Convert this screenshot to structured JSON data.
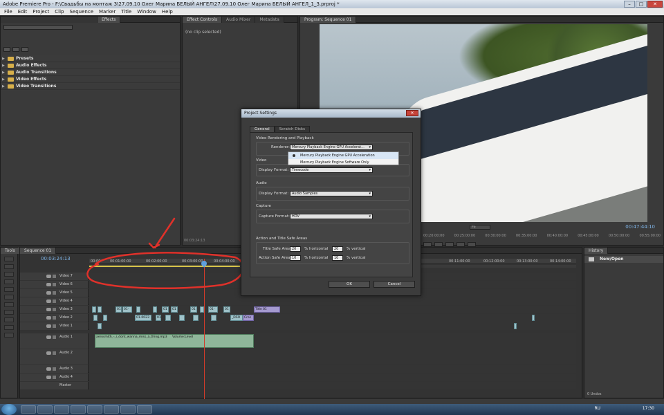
{
  "app": {
    "title": "Adobe Premiere Pro - F:\\Свадьбы на монтаж 3\\27.09.10 Олег Марина БЕЛЫЙ АНГЕЛ\\27.09.10 Олег Марина БЕЛЫЙ АНГЕЛ_1_3.prproj *"
  },
  "menu": [
    "File",
    "Edit",
    "Project",
    "Clip",
    "Sequence",
    "Marker",
    "Title",
    "Window",
    "Help"
  ],
  "effects_panel": {
    "tab": "Effects",
    "items": [
      "Presets",
      "Audio Effects",
      "Audio Transitions",
      "Video Effects",
      "Video Transitions"
    ]
  },
  "effect_controls": {
    "tabs": [
      "Effect Controls",
      "Audio Mixer",
      "Metadata"
    ],
    "clip_status": "(no clip selected)",
    "timecode": "00:03:24:13"
  },
  "program": {
    "tab": "Program: Sequence 01",
    "timecode": "00:47:44:10",
    "fit": "Fit",
    "ruler": [
      "00:20:00:00",
      "00:25:00:00",
      "00:30:00:00",
      "00:35:00:00",
      "00:40:00:00",
      "00:45:00:00",
      "00:50:00:00",
      "00:55:00:00"
    ]
  },
  "tools_panel": {
    "tab": "Tools"
  },
  "sequence": {
    "tab": "Sequence 01",
    "timecode": "00:03:24:13",
    "ruler": [
      "00:00",
      "00:01:00:00",
      "00:02:00:00",
      "00:03:00:00",
      "00:04:00:00"
    ],
    "ruler_right": [
      "00:11:00:00",
      "00:12:00:00",
      "00:13:00:00",
      "00:14:00:00"
    ],
    "tracks": [
      {
        "name": "Video 7"
      },
      {
        "name": "Video 6"
      },
      {
        "name": "Video 5"
      },
      {
        "name": "Video 4"
      },
      {
        "name": "Video 3"
      },
      {
        "name": "Video 2"
      },
      {
        "name": "Video 1"
      },
      {
        "name": "Audio 1"
      },
      {
        "name": "Audio 2"
      },
      {
        "name": "Audio 3"
      },
      {
        "name": "Audio 4"
      },
      {
        "name": "Master"
      }
    ],
    "clips": {
      "v3_labels": [
        "01",
        "01-",
        "01",
        "01",
        "01",
        "01-",
        "01"
      ],
      "v3_title": "Title 01",
      "v2_labels": [
        "01-0023",
        "01",
        "_DSO",
        "Cros"
      ],
      "a1_label": "aerosmith_-_i_dont_wanna_miss_a_thing.mp3",
      "a1_volume": "Volume:Level"
    }
  },
  "history": {
    "tab": "History",
    "item": "New/Open",
    "undos": "0 Undos"
  },
  "dialog": {
    "title": "Project Settings",
    "close": "✕",
    "tabs": [
      "General",
      "Scratch Disks"
    ],
    "video_rendering": {
      "group": "Video Rendering and Playback",
      "label": "Renderer:",
      "value": "Mercury Playback Engine GPU Accelerat...",
      "options": [
        "Mercury Playback Engine GPU Acceleration",
        "Mercury Playback Engine Software Only"
      ]
    },
    "video": {
      "group": "Video",
      "label": "Display Format:",
      "value": "Timecode"
    },
    "audio": {
      "group": "Audio",
      "label": "Display Format:",
      "value": "Audio Samples"
    },
    "capture": {
      "group": "Capture",
      "label": "Capture Format:",
      "value": "HDV"
    },
    "safe_areas": {
      "group": "Action and Title Safe Areas",
      "title_label": "Title Safe Area",
      "title_h": "20",
      "title_v": "20",
      "action_label": "Action Safe Area",
      "action_h": "10",
      "action_v": "10",
      "h_unit": "% horizontal",
      "v_unit": "% vertical"
    },
    "ok": "OK",
    "cancel": "Cancel"
  },
  "taskbar": {
    "lang": "RU",
    "clock": "17:30"
  },
  "colors": {
    "playhead": "#d23b2a",
    "timecode": "#7fb4e6",
    "annotation": "#e0312a"
  }
}
